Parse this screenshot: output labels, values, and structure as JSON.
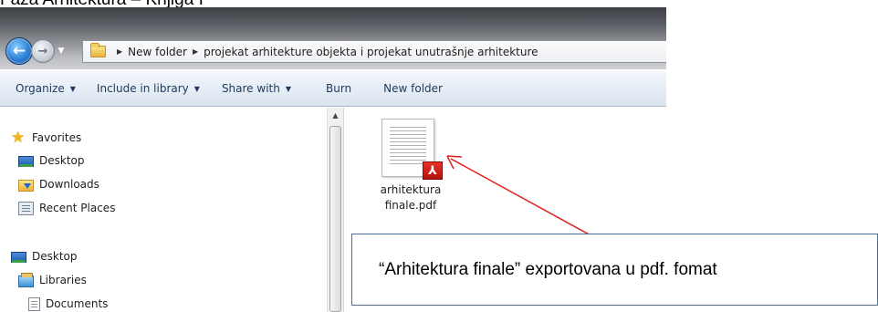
{
  "heading_fragment": "Faza Arhitektura – Knjiga I",
  "address": {
    "crumbs": [
      "New folder",
      "projekat arhitekture objekta i projekat unutrašnje arhitekture"
    ]
  },
  "command_bar": {
    "organize": "Organize",
    "include_in_library": "Include in library",
    "share_with": "Share with",
    "burn": "Burn",
    "new_folder": "New folder"
  },
  "nav_pane": {
    "favorites": "Favorites",
    "desktop_fav": "Desktop",
    "downloads": "Downloads",
    "recent_places": "Recent Places",
    "desktop": "Desktop",
    "libraries": "Libraries",
    "documents": "Documents"
  },
  "file": {
    "name_line1": "arhitektura",
    "name_line2": "finale.pdf",
    "badge": "⅄"
  },
  "annotation": {
    "callout_text": "“Arhitektura finale” exportovana u pdf. fomat",
    "arrow_color": "#e0201b"
  }
}
